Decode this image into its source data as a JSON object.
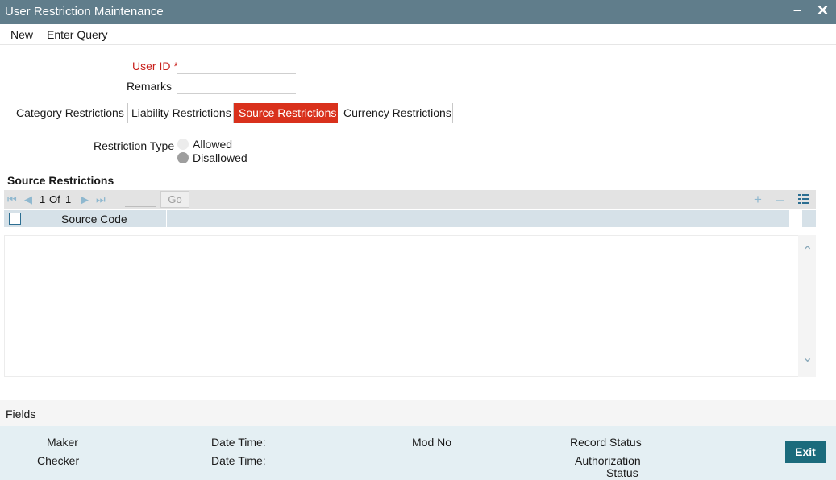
{
  "window": {
    "title": "User Restriction Maintenance",
    "minimize_glyph": "–",
    "close_glyph": "✕"
  },
  "menu": {
    "new_label": "New",
    "enter_query_label": "Enter Query"
  },
  "form": {
    "user_id_label": "User ID",
    "required_mark": "*",
    "user_id_value": "",
    "remarks_label": "Remarks",
    "remarks_value": ""
  },
  "tabs": [
    {
      "label": "Category Restrictions",
      "active": false
    },
    {
      "label": "Liability Restrictions",
      "active": false
    },
    {
      "label": "Source Restrictions",
      "active": true
    },
    {
      "label": "Currency Restrictions",
      "active": false
    }
  ],
  "restriction": {
    "label": "Restriction Type",
    "options": [
      {
        "label": "Allowed",
        "selected": false
      },
      {
        "label": "Disallowed",
        "selected": true
      }
    ]
  },
  "grid": {
    "section_title": "Source Restrictions",
    "pager": {
      "current": "1",
      "of_label": "Of",
      "total": "1"
    },
    "go_label": "Go",
    "columns": [
      "Source Code"
    ],
    "rows": [],
    "icons": {
      "first": "first-page-icon",
      "prev": "prev-page-icon",
      "next": "next-page-icon",
      "last": "last-page-icon",
      "add": "plus-icon",
      "delete": "minus-icon",
      "view": "list-view-icon"
    }
  },
  "fields_label": "Fields",
  "audit": {
    "maker_label": "Maker",
    "checker_label": "Checker",
    "date_time_label": "Date Time:",
    "mod_no_label": "Mod No",
    "record_status_label": "Record Status",
    "authorization_label": "Authorization",
    "status_label": "Status"
  },
  "exit_label": "Exit",
  "colors": {
    "titlebar": "#607d8b",
    "active_tab": "#d9311c",
    "required": "#c8201c",
    "exit_button": "#1b6b7c",
    "footer": "#e4eff3"
  }
}
